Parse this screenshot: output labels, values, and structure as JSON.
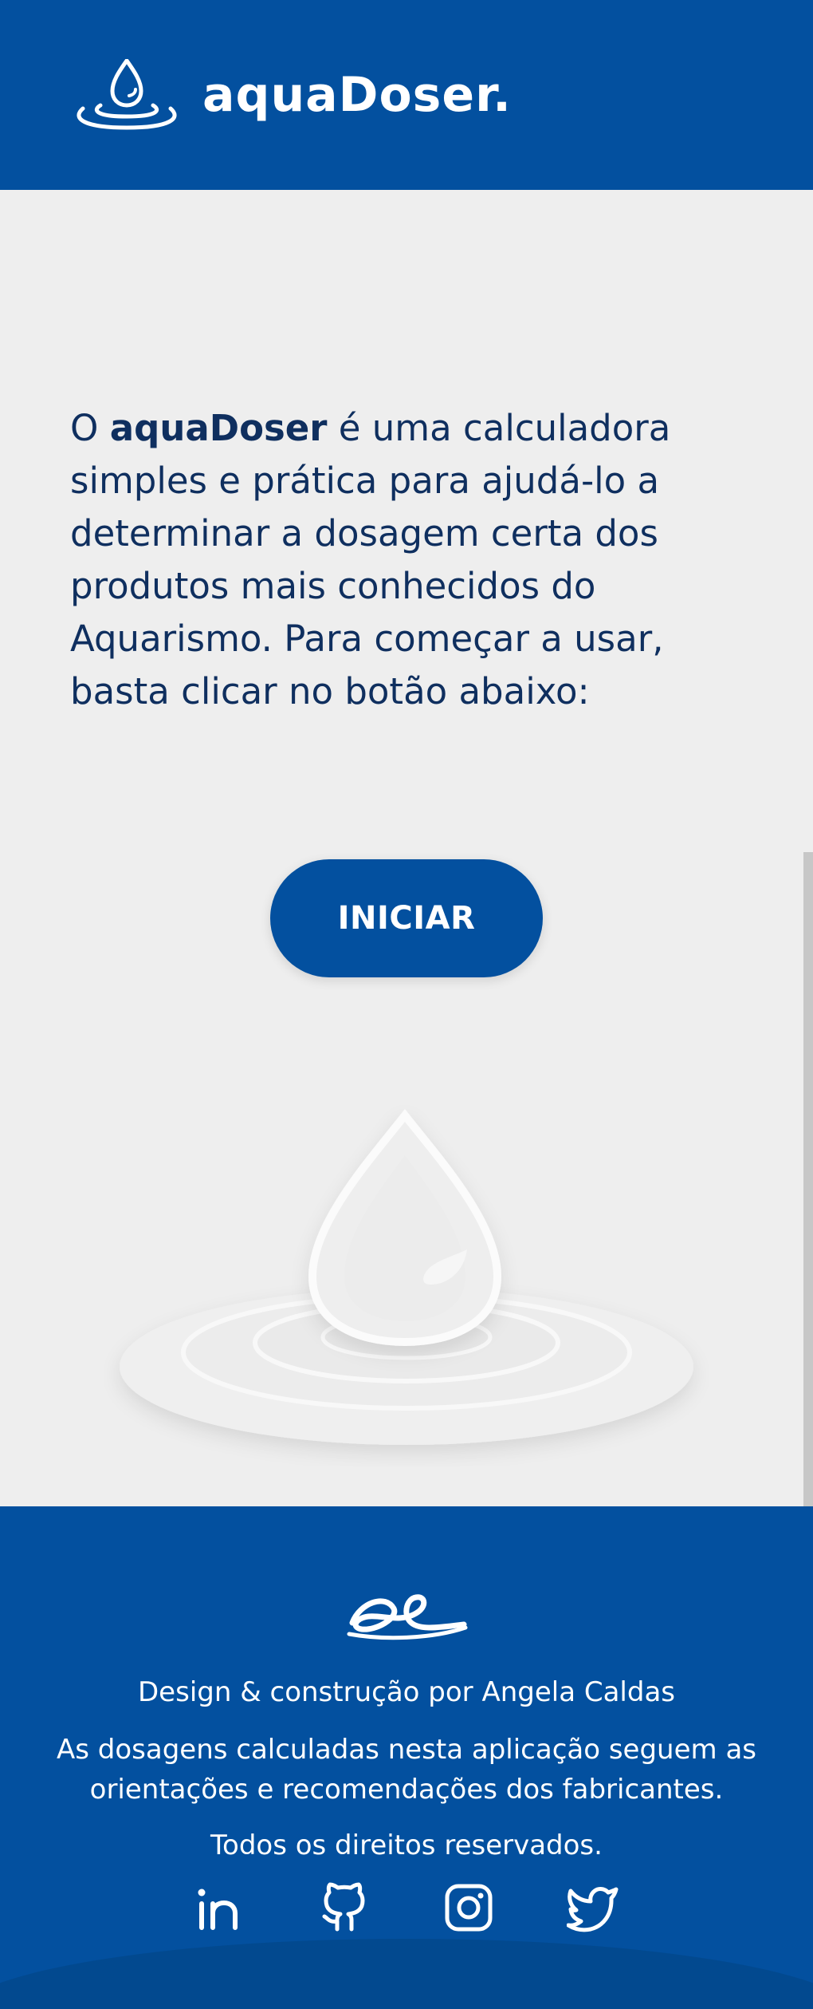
{
  "brand": {
    "name": "aquaDoser."
  },
  "intro": {
    "prefix": "O ",
    "brand": "aquaDoser",
    "text": " é uma calculadora simples e prática para ajudá-lo a determinar a dosagem certa dos produtos mais conhecidos do Aquarismo. Para começar a usar, basta clicar no botão abaixo:"
  },
  "start_button": {
    "label": "INICIAR"
  },
  "footer": {
    "credit": "Design & construção por Angela Caldas",
    "disclaimer": "As dosagens calculadas nesta aplicação seguem as orientações e recomendações dos fabricantes.",
    "rights": "Todos os direitos reservados.",
    "socials": [
      {
        "icon": "linkedin-icon"
      },
      {
        "icon": "github-icon"
      },
      {
        "icon": "instagram-icon"
      },
      {
        "icon": "twitter-icon"
      }
    ]
  },
  "colors": {
    "primary": "#03509f",
    "background": "#eeeeee",
    "text": "#0f2f5f",
    "white": "#ffffff"
  }
}
